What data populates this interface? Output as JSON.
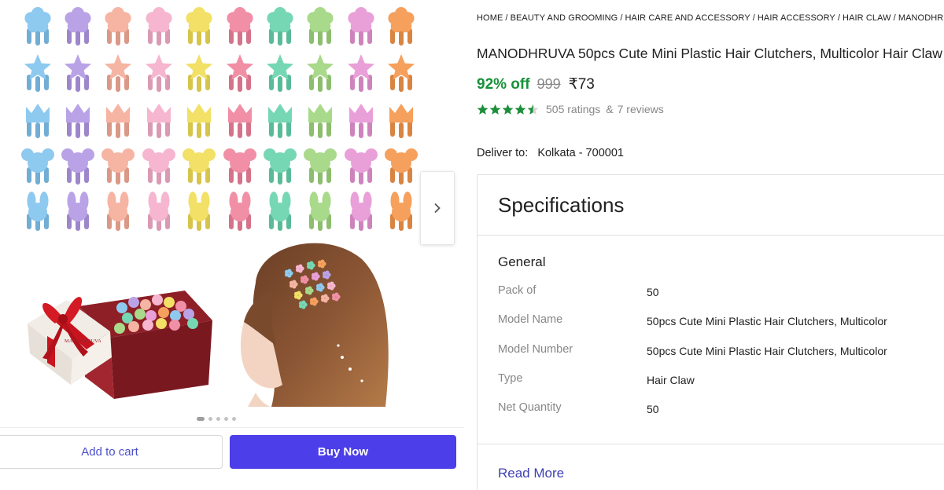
{
  "breadcrumb": [
    "HOME",
    "BEAUTY AND GROOMING",
    "HAIR CARE AND ACCESSORY",
    "HAIR ACCESSORY",
    "HAIR CLAW",
    "MANODHRUVA H"
  ],
  "product": {
    "title": "MANODHRUVA 50pcs Cute Mini Plastic Hair Clutchers, Multicolor Hair Claw",
    "discount": "92% off",
    "mrp": "999",
    "price": "₹73",
    "rating_stars": 4.5,
    "ratings": "505 ratings",
    "reviews_sep": "&",
    "reviews": "7 reviews"
  },
  "deliver": {
    "label": "Deliver to:",
    "location": "Kolkata - 700001"
  },
  "gallery": {
    "clip_colors": [
      "#8ec9ef",
      "#b9a3e6",
      "#f6b4a3",
      "#f6b6cf",
      "#f2e067",
      "#f18fa6",
      "#76d7b4",
      "#a9d98a",
      "#e9a0d8",
      "#f6a05d"
    ],
    "clip_shapes": [
      "flower",
      "star",
      "crown",
      "mouse",
      "bunny"
    ],
    "images_count": 5,
    "active_image": 1,
    "box_brand": "MANODHRUVA"
  },
  "actions": {
    "add_to_cart": "Add to cart",
    "buy_now": "Buy Now"
  },
  "specifications": {
    "heading": "Specifications",
    "group": "General",
    "rows": [
      {
        "key": "Pack of",
        "value": "50"
      },
      {
        "key": "Model Name",
        "value": "50pcs Cute Mini Plastic Hair Clutchers, Multicolor"
      },
      {
        "key": "Model Number",
        "value": "50pcs Cute Mini Plastic Hair Clutchers, Multicolor"
      },
      {
        "key": "Type",
        "value": "Hair Claw"
      },
      {
        "key": "Net Quantity",
        "value": "50"
      }
    ],
    "read_more": "Read More"
  },
  "colors": {
    "accent": "#4c3ee8",
    "discount_green": "#17923a",
    "star_green": "#1c8f3a",
    "link": "#3f3fb6"
  }
}
